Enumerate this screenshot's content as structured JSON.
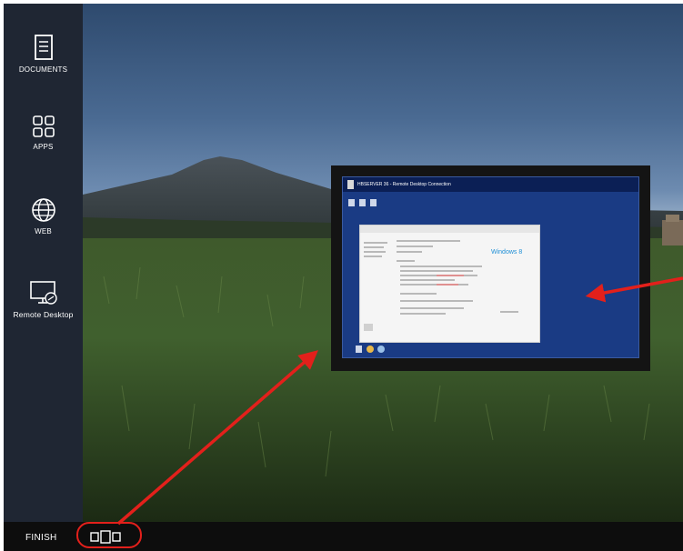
{
  "sidebar": {
    "items": [
      {
        "label": "DOCUMENTS",
        "icon": "document-icon"
      },
      {
        "label": "APPS",
        "icon": "apps-grid-icon"
      },
      {
        "label": "WEB",
        "icon": "globe-icon"
      },
      {
        "label": "Remote Desktop",
        "icon": "remote-desktop-icon"
      }
    ]
  },
  "taskbar": {
    "finish_label": "FINISH",
    "task_view_icon": "task-view-icon"
  },
  "remote_window": {
    "title": "HBSERVER 36 - Remote Desktop Connection",
    "os_label": "Windows 8"
  },
  "colors": {
    "sidebar": "#1f2633",
    "taskbar": "#0d0d0d",
    "annotation": "#e3201b",
    "remote_desktop_bg": "#1a3b84"
  }
}
